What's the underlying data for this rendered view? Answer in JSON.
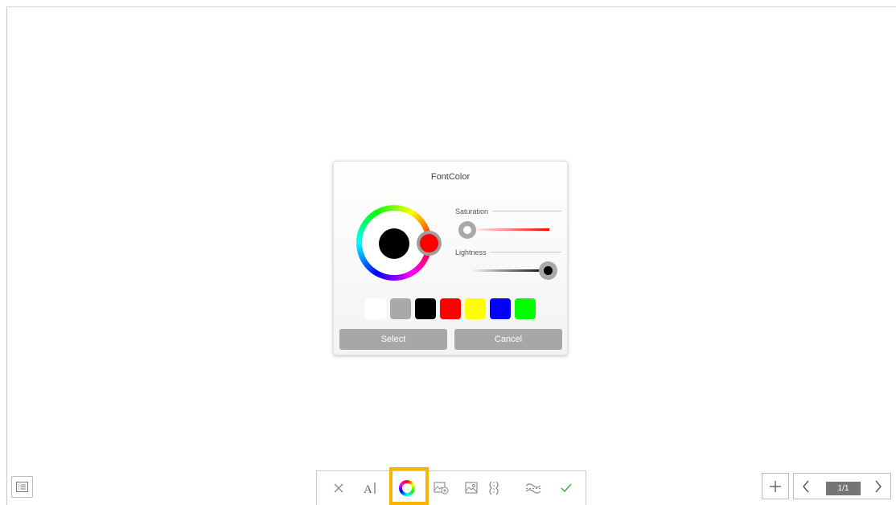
{
  "dialog": {
    "title": "FontColor",
    "saturation_label": "Saturation",
    "lightness_label": "Lightness",
    "selected_color": "#000000",
    "hue_color": "#ff0000",
    "saturation": 0,
    "lightness": 1,
    "swatches": [
      "#ffffff",
      "#a9a9a9",
      "#000000",
      "#ff0000",
      "#ffff00",
      "#0000ff",
      "#00ff00"
    ],
    "select_label": "Select",
    "cancel_label": "Cancel"
  },
  "toolbar": {
    "items": [
      "close-icon",
      "text-style-icon",
      "font-color-icon",
      "image-add-icon",
      "image-icon",
      "split-icon",
      "wrap-icon",
      "check-icon"
    ],
    "active": "font-color-icon",
    "highlight_color": "#f8b400"
  },
  "navigation": {
    "page_indicator": "1/1"
  }
}
